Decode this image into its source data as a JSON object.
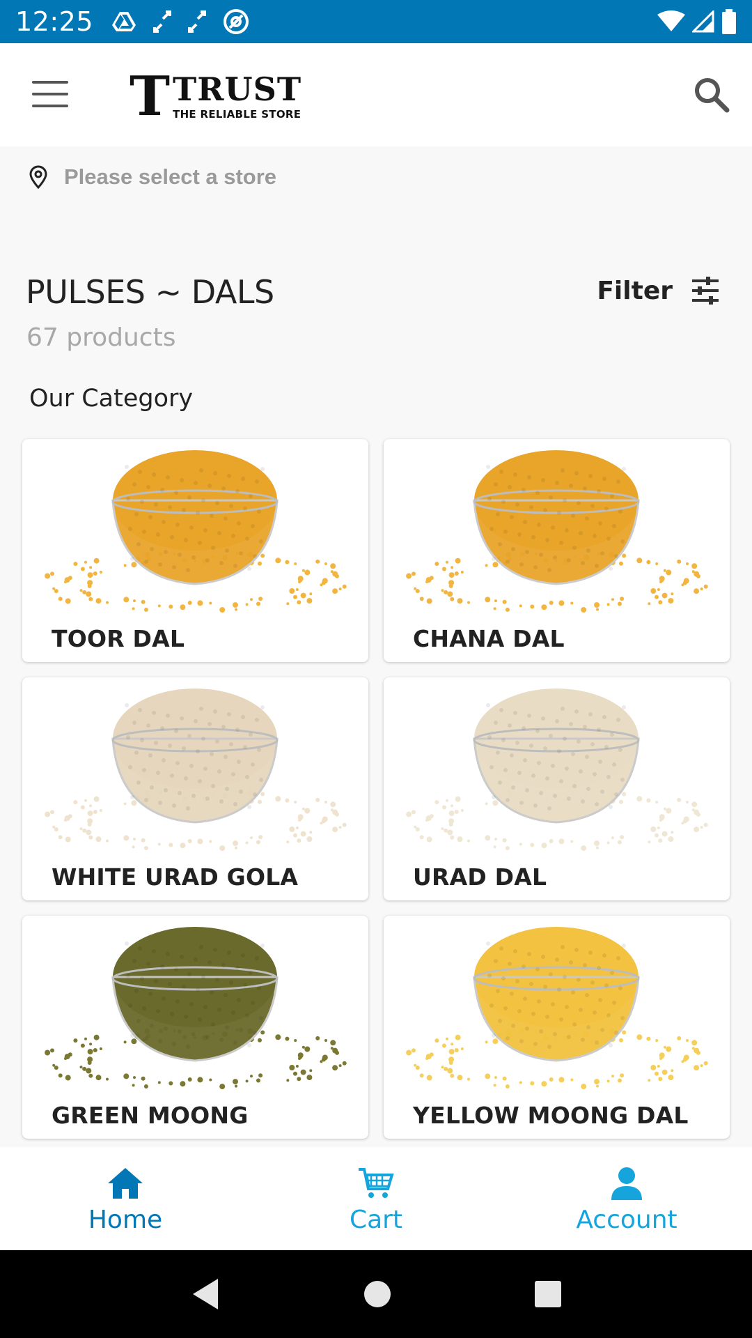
{
  "status_bar": {
    "time": "12:25",
    "left_icons": [
      "drive-icon",
      "sync-icon",
      "sync-icon",
      "at-icon"
    ],
    "right_icons": [
      "wifi-icon",
      "signal-icon",
      "battery-icon"
    ],
    "background": "#0277b5"
  },
  "header": {
    "logo_mark": "T",
    "logo_name": "TRUST",
    "logo_tagline": "THE RELIABLE STORE",
    "menu_icon": "hamburger-icon",
    "search_icon": "search-icon"
  },
  "store": {
    "icon": "location-pin-icon",
    "text": "Please select a store"
  },
  "page": {
    "title": "PULSES ~ DALS",
    "count": "67 products",
    "filter_label": "Filter",
    "filter_icon": "sliders-icon",
    "section_title": "Our Category"
  },
  "categories": [
    {
      "label": "TOOR DAL",
      "bowl_color": "#e9a52a",
      "grain_color": "#f2b640"
    },
    {
      "label": "CHANA DAL",
      "bowl_color": "#e9a52a",
      "grain_color": "#f2b640"
    },
    {
      "label": "WHITE URAD GOLA",
      "bowl_color": "#e6d6bd",
      "grain_color": "#efe3cf"
    },
    {
      "label": "URAD DAL",
      "bowl_color": "#e8dcc4",
      "grain_color": "#efe6d4"
    },
    {
      "label": "GREEN MOONG",
      "bowl_color": "#6a6a2c",
      "grain_color": "#7a7832"
    },
    {
      "label": "YELLOW MOONG DAL",
      "bowl_color": "#f2c240",
      "grain_color": "#f6cf5a"
    }
  ],
  "bottom_nav": [
    {
      "label": "Home",
      "icon": "home-icon",
      "color": "#0277b5"
    },
    {
      "label": "Cart",
      "icon": "cart-icon",
      "color": "#15a4dc"
    },
    {
      "label": "Account",
      "icon": "account-icon",
      "color": "#15a4dc"
    }
  ],
  "system_nav": [
    "back-icon",
    "home-circle-icon",
    "recents-icon"
  ]
}
